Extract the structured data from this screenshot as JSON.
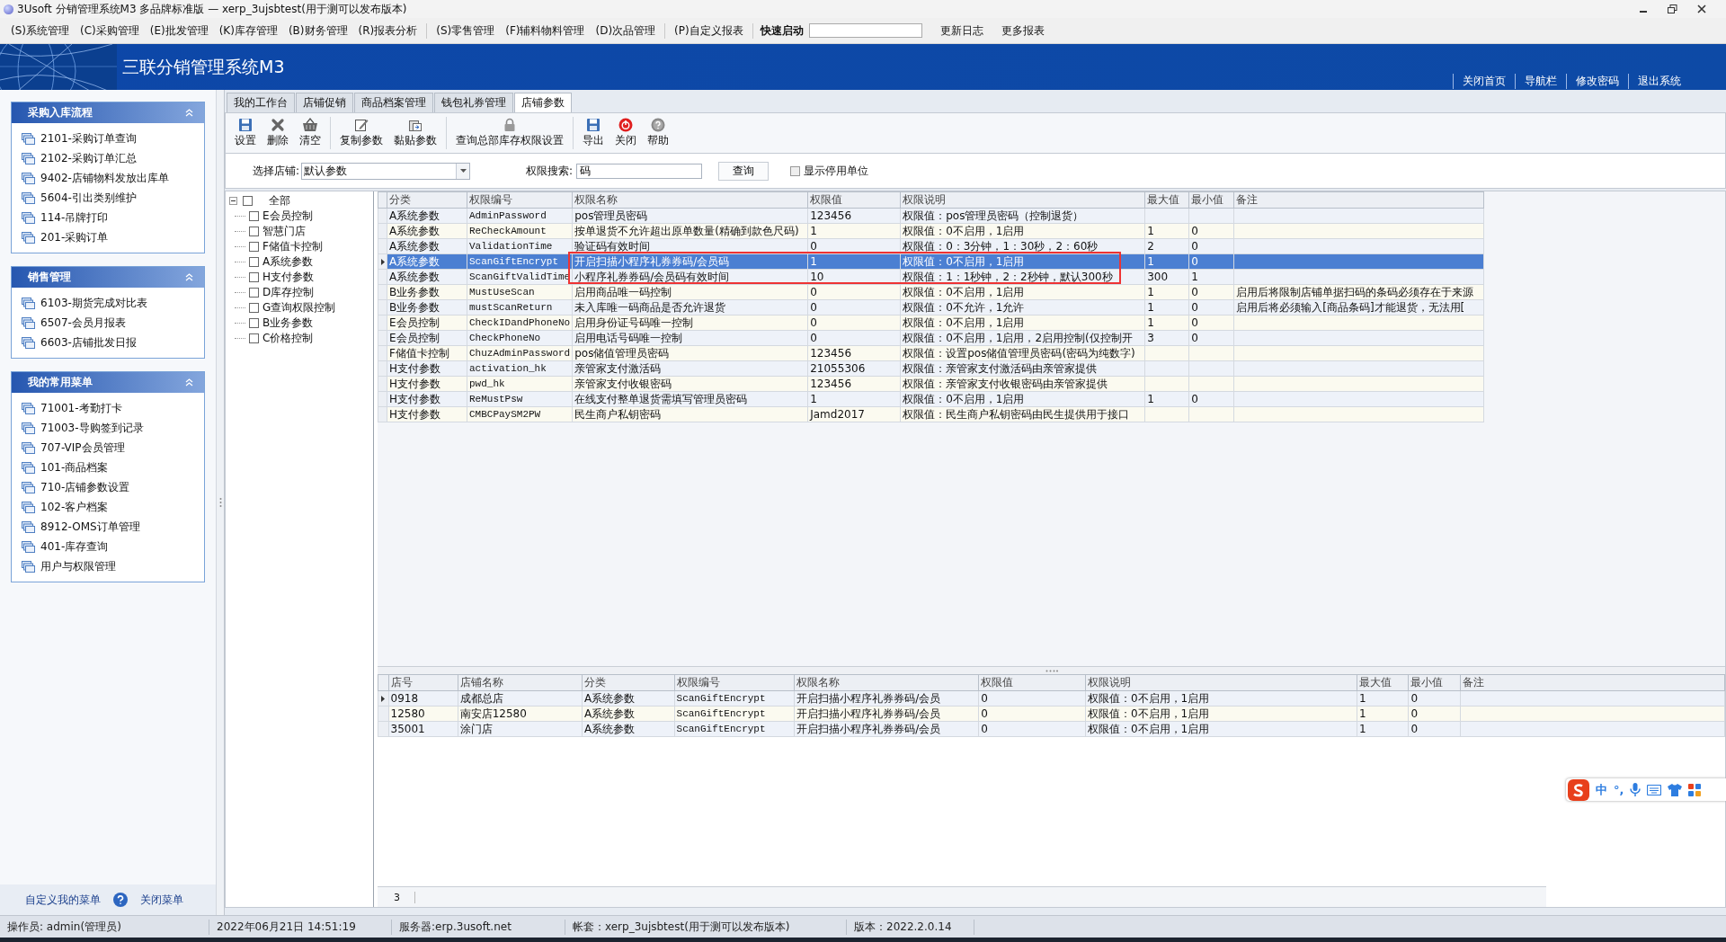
{
  "window": {
    "title": "3Usoft 分销管理系统M3 多品牌标准版 — xerp_3ujsbtest(用于测可以发布版本)"
  },
  "menu": [
    {
      "label": "(S)系统管理",
      "group_end": false
    },
    {
      "label": "(C)采购管理",
      "group_end": false
    },
    {
      "label": "(E)批发管理",
      "group_end": false
    },
    {
      "label": "(K)库存管理",
      "group_end": false
    },
    {
      "label": "(B)财务管理",
      "group_end": false
    },
    {
      "label": "(R)报表分析",
      "group_end": true
    },
    {
      "label": "(S)零售管理",
      "group_end": false
    },
    {
      "label": "(F)辅料物料管理",
      "group_end": false
    },
    {
      "label": "(D)次品管理",
      "group_end": true
    },
    {
      "label": "(P)自定义报表",
      "group_end": true
    }
  ],
  "quick_launch": {
    "label": "快速启动"
  },
  "menu_links": [
    "更新日志",
    "更多报表"
  ],
  "banner": {
    "title": "三联分销管理系统M3",
    "links": [
      "关闭首页",
      "导航栏",
      "修改密码",
      "退出系统"
    ]
  },
  "sidebar": {
    "panels": [
      {
        "title": "采购入库流程",
        "items": [
          "2101-采购订单查询",
          "2102-采购订单汇总",
          "9402-店铺物料发放出库单",
          "5604-引出类别维护",
          "114-吊牌打印",
          "201-采购订单"
        ]
      },
      {
        "title": "销售管理",
        "items": [
          "6103-期货完成对比表",
          "6507-会员月报表",
          "6603-店铺批发日报"
        ]
      },
      {
        "title": "我的常用菜单",
        "items": [
          "71001-考勤打卡",
          "71003-导购签到记录",
          "707-VIP会员管理",
          "101-商品档案",
          "710-店铺参数设置",
          "102-客户档案",
          "8912-OMS订单管理",
          "401-库存查询",
          "用户与权限管理"
        ]
      }
    ],
    "footer": {
      "customize": "自定义我的菜单",
      "close": "关闭菜单"
    }
  },
  "tabs": [
    {
      "label": "我的工作台",
      "selected": false
    },
    {
      "label": "店铺促销",
      "selected": false
    },
    {
      "label": "商品档案管理",
      "selected": false
    },
    {
      "label": "钱包礼券管理",
      "selected": false
    },
    {
      "label": "店铺参数",
      "selected": true
    }
  ],
  "toolbar": [
    [
      {
        "label": "设置",
        "kind": "save"
      },
      {
        "label": "删除",
        "kind": "delete"
      },
      {
        "label": "清空",
        "kind": "clear"
      }
    ],
    [
      {
        "label": "复制参数",
        "kind": "copy"
      },
      {
        "label": "黏贴参数",
        "kind": "paste"
      }
    ],
    [
      {
        "label": "查询总部库存权限设置",
        "kind": "lock"
      }
    ],
    [
      {
        "label": "导出",
        "kind": "export"
      },
      {
        "label": "关闭",
        "kind": "power"
      },
      {
        "label": "帮助",
        "kind": "help"
      }
    ]
  ],
  "filters": {
    "store_label": "选择店铺:",
    "store_value": "默认参数",
    "search_label": "权限搜索:",
    "search_value": "码",
    "query_button": "查询",
    "show_disabled": {
      "label": "显示停用单位",
      "checked": false
    }
  },
  "tree": {
    "label": "全部",
    "checked": false,
    "expanded": true,
    "children": [
      {
        "label": "E会员控制",
        "checked": false
      },
      {
        "label": "智慧门店",
        "checked": false
      },
      {
        "label": "F储值卡控制",
        "checked": false
      },
      {
        "label": "A系统参数",
        "checked": false
      },
      {
        "label": "H支付参数",
        "checked": false
      },
      {
        "label": "D库存控制",
        "checked": false
      },
      {
        "label": "G查询权限控制",
        "checked": false
      },
      {
        "label": "B业务参数",
        "checked": false
      },
      {
        "label": "C价格控制",
        "checked": false
      }
    ]
  },
  "table": {
    "columns": [
      "分类",
      "权限编号",
      "权限名称",
      "权限值",
      "权限说明",
      "最大值",
      "最小值",
      "备注"
    ],
    "rows": [
      {
        "category": "A系统参数",
        "code": "AdminPassword",
        "name": "pos管理员密码",
        "value": "123456",
        "description": "权限值：pos管理员密码（控制退货）",
        "max": "",
        "min": "",
        "note": "",
        "selected": false,
        "highlighted": false
      },
      {
        "category": "A系统参数",
        "code": "ReCheckAmount",
        "name": "按单退货不允许超出原单数量(精确到款色尺码)",
        "value": "1",
        "description": "权限值：0不启用，1启用",
        "max": "1",
        "min": "0",
        "note": "",
        "selected": false,
        "highlighted": false
      },
      {
        "category": "A系统参数",
        "code": "ValidationTime",
        "name": "验证码有效时间",
        "value": "0",
        "description": "权限值：0：3分钟，1：30秒，2：60秒",
        "max": "2",
        "min": "0",
        "note": "",
        "selected": false,
        "highlighted": false
      },
      {
        "category": "A系统参数",
        "code": "ScanGiftEncrypt",
        "name": "开启扫描小程序礼券券码/会员码",
        "value": "1",
        "description": "权限值：0不启用，1启用",
        "max": "1",
        "min": "0",
        "note": "",
        "selected": true,
        "highlighted": true
      },
      {
        "category": "A系统参数",
        "code": "ScanGiftValidTime",
        "name": "小程序礼券券码/会员码有效时间",
        "value": "10",
        "description": "权限值：1：1秒钟，2：2秒钟，默认300秒",
        "max": "300",
        "min": "1",
        "note": "",
        "selected": false,
        "highlighted": true
      },
      {
        "category": "B业务参数",
        "code": "MustUseScan",
        "name": "启用商品唯一码控制",
        "value": "0",
        "description": "权限值：0不启用，1启用",
        "max": "1",
        "min": "0",
        "note": "启用后将限制店铺单据扫码的条码必须存在于来源",
        "selected": false,
        "highlighted": false
      },
      {
        "category": "B业务参数",
        "code": "mustScanReturn",
        "name": "未入库唯一码商品是否允许退货",
        "value": "0",
        "description": "权限值：0不允许，1允许",
        "max": "1",
        "min": "0",
        "note": "启用后将必须输入[商品条码]才能退货，无法用[",
        "selected": false,
        "highlighted": false
      },
      {
        "category": "E会员控制",
        "code": "CheckIDandPhoneNo",
        "name": "启用身份证号码唯一控制",
        "value": "0",
        "description": "权限值：0不启用，1启用",
        "max": "1",
        "min": "0",
        "note": "",
        "selected": false,
        "highlighted": false
      },
      {
        "category": "E会员控制",
        "code": "CheckPhoneNo",
        "name": "启用电话号码唯一控制",
        "value": "0",
        "description": "权限值：0不启用，1启用，2启用控制(仅控制开",
        "max": "3",
        "min": "0",
        "note": "",
        "selected": false,
        "highlighted": false
      },
      {
        "category": "F储值卡控制",
        "code": "ChuzAdminPassword",
        "name": "pos储值管理员密码",
        "value": "123456",
        "description": "权限值：设置pos储值管理员密码(密码为纯数字)",
        "max": "",
        "min": "",
        "note": "",
        "selected": false,
        "highlighted": false
      },
      {
        "category": "H支付参数",
        "code": "activation_hk",
        "name": "亲管家支付激活码",
        "value": "21055306",
        "description": "权限值：亲管家支付激活码由亲管家提供",
        "max": "",
        "min": "",
        "note": "",
        "selected": false,
        "highlighted": false
      },
      {
        "category": "H支付参数",
        "code": "pwd_hk",
        "name": "亲管家支付收银密码",
        "value": "123456",
        "description": "权限值：亲管家支付收银密码由亲管家提供",
        "max": "",
        "min": "",
        "note": "",
        "selected": false,
        "highlighted": false
      },
      {
        "category": "H支付参数",
        "code": "ReMustPsw",
        "name": "在线支付整单退货需填写管理员密码",
        "value": "1",
        "description": "权限值：0不启用，1启用",
        "max": "1",
        "min": "0",
        "note": "",
        "selected": false,
        "highlighted": false
      },
      {
        "category": "H支付参数",
        "code": "CMBCPaySM2PW",
        "name": "民生商户私钥密码",
        "value": "Jamd2017",
        "description": "权限值：民生商户私钥密码由民生提供用于接口",
        "max": "",
        "min": "",
        "note": "",
        "selected": false,
        "highlighted": false
      }
    ]
  },
  "store_table": {
    "columns": [
      "店号",
      "店铺名称",
      "分类",
      "权限编号",
      "权限名称",
      "权限值",
      "权限说明",
      "最大值",
      "最小值",
      "备注"
    ],
    "rows": [
      {
        "store_no": "0918",
        "store_name": "成都总店",
        "category": "A系统参数",
        "code": "ScanGiftEncrypt",
        "name": "开启扫描小程序礼券券码/会员",
        "value": "0",
        "description": "权限值：0不启用，1启用",
        "max": "1",
        "min": "0",
        "note": "",
        "selected": true
      },
      {
        "store_no": "12580",
        "store_name": "南安店12580",
        "category": "A系统参数",
        "code": "ScanGiftEncrypt",
        "name": "开启扫描小程序礼券券码/会员",
        "value": "0",
        "description": "权限值：0不启用，1启用",
        "max": "1",
        "min": "0",
        "note": "",
        "selected": false
      },
      {
        "store_no": "35001",
        "store_name": "涂门店",
        "category": "A系统参数",
        "code": "ScanGiftEncrypt",
        "name": "开启扫描小程序礼券券码/会员",
        "value": "0",
        "description": "权限值：0不启用，1启用",
        "max": "1",
        "min": "0",
        "note": "",
        "selected": false
      }
    ],
    "row_count": "3"
  },
  "ime_toolbar": {
    "mode": "中",
    "punctuation": "°,"
  },
  "status_bar": [
    "操作员: admin(管理员)",
    "2022年06月21日 14:51:19",
    "服务器:erp.3usoft.net",
    "帐套：xerp_3ujsbtest(用于测可以发布版本)",
    "版本：2022.2.0.14"
  ]
}
